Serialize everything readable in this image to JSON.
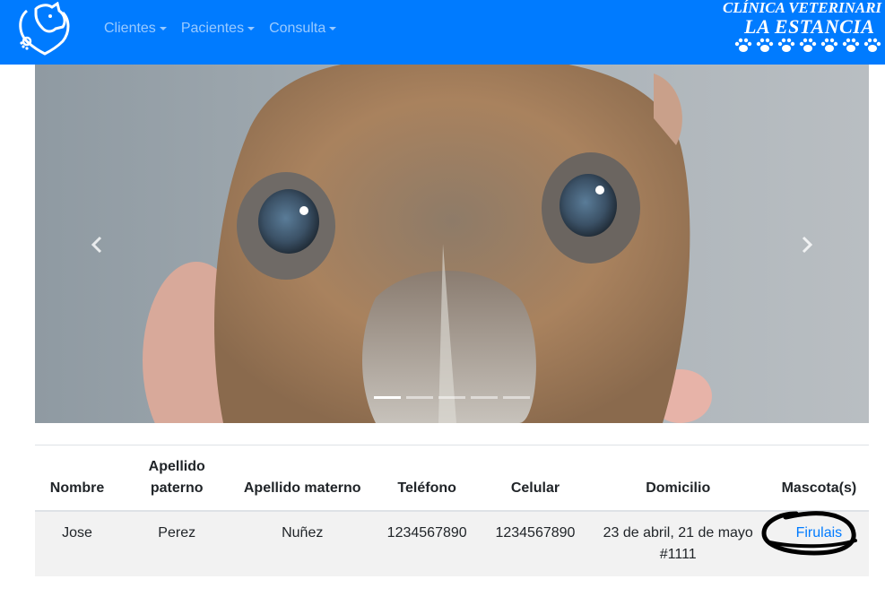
{
  "navbar": {
    "menu": [
      {
        "label": "Clientes"
      },
      {
        "label": "Pacientes"
      },
      {
        "label": "Consulta"
      }
    ],
    "brand_line1": "CLÍNICA VETERINARI",
    "brand_line2": "LA ESTANCIA",
    "accent_color": "#007bff"
  },
  "carousel": {
    "prev_icon": "chevron-left-icon",
    "next_icon": "chevron-right-icon",
    "slide_count": 5,
    "active_slide": 1
  },
  "table": {
    "headers": [
      "Nombre",
      "Apellido paterno",
      "Apellido materno",
      "Teléfono",
      "Celular",
      "Domicilio",
      "Mascota(s)"
    ],
    "rows": [
      {
        "nombre": "Jose",
        "apellido_paterno": "Perez",
        "apellido_materno": "Nuñez",
        "telefono": "1234567890",
        "celular": "1234567890",
        "domicilio": "23 de abril, 21 de mayo #1111",
        "mascota": "Firulais"
      }
    ]
  }
}
